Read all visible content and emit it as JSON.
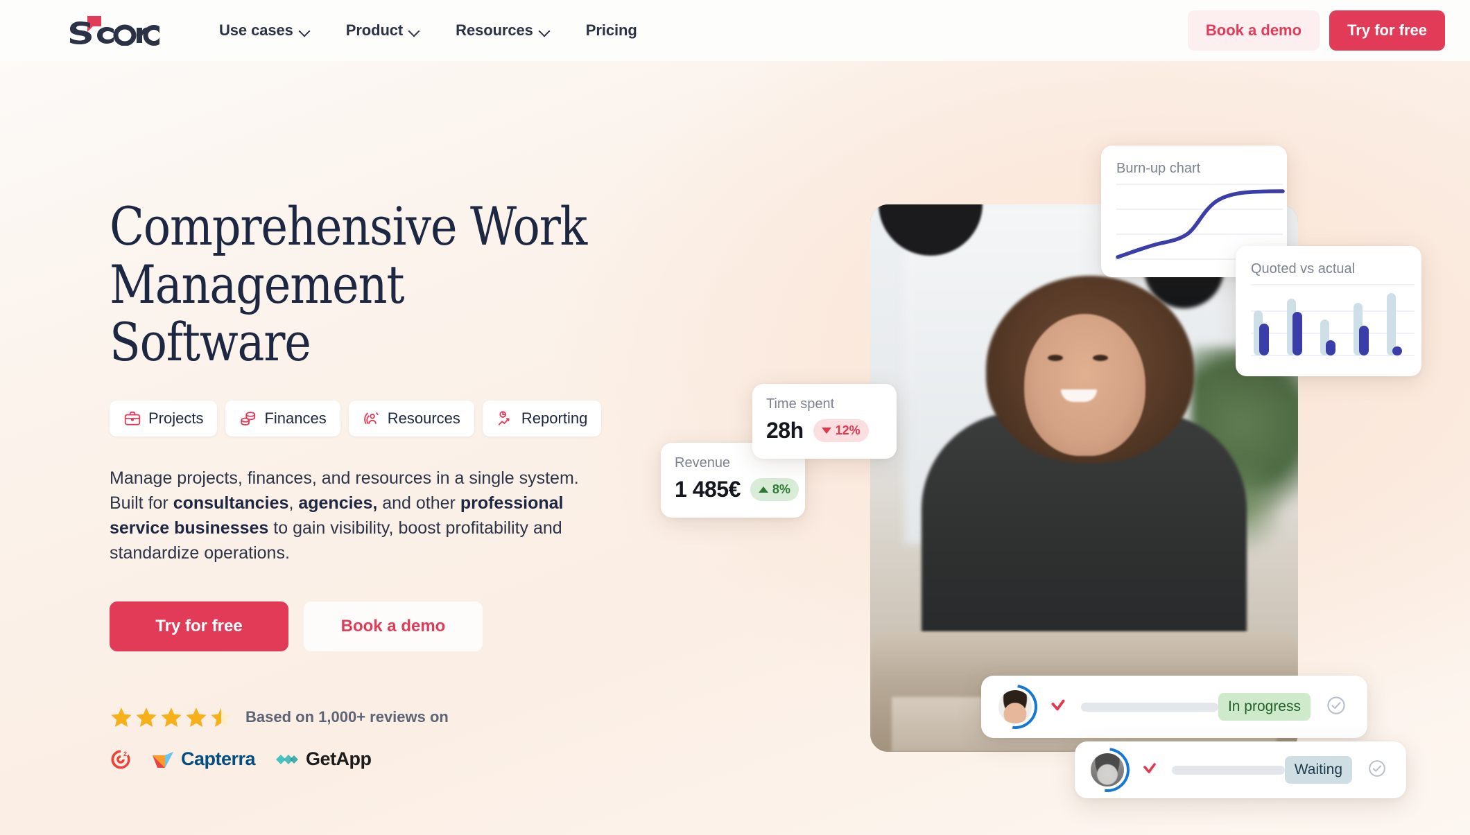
{
  "brand": {
    "name": "Scoro",
    "primary_color": "#e23b58",
    "text_color": "#1e2742"
  },
  "header": {
    "logo_text": "Scoro",
    "nav": [
      {
        "label": "Use cases",
        "has_dropdown": true
      },
      {
        "label": "Product",
        "has_dropdown": true
      },
      {
        "label": "Resources",
        "has_dropdown": true
      },
      {
        "label": "Pricing",
        "has_dropdown": false
      }
    ],
    "book_demo_label": "Book a demo",
    "try_free_label": "Try for free"
  },
  "hero": {
    "headline": "Comprehensive Work\nManagement Software",
    "pills": [
      {
        "label": "Projects",
        "icon": "briefcase-icon"
      },
      {
        "label": "Finances",
        "icon": "coins-icon"
      },
      {
        "label": "Resources",
        "icon": "person-target-icon"
      },
      {
        "label": "Reporting",
        "icon": "chart-line-icon"
      }
    ],
    "lede": {
      "part1": "Manage projects, finances, and resources in a single system. Built for ",
      "bold1": "consultancies",
      "part2": ", ",
      "bold2": "agencies,",
      "part3": " and other ",
      "bold3": "professional service businesses",
      "part4": " to gain visibility, boost profitability and standardize operations."
    },
    "cta_primary": "Try for free",
    "cta_secondary": "Book a demo"
  },
  "reviews": {
    "rating": 4.5,
    "max_rating": 5,
    "text": "Based on 1,000+ reviews on",
    "platforms": [
      {
        "name": "G2",
        "label": "",
        "icon": "g2-logo"
      },
      {
        "name": "Capterra",
        "label": "Capterra",
        "icon": "capterra-logo"
      },
      {
        "name": "GetApp",
        "label": "GetApp",
        "icon": "getapp-logo"
      }
    ]
  },
  "cards": {
    "burnup": {
      "title": "Burn-up chart"
    },
    "quoted": {
      "title": "Quoted vs actual"
    },
    "time_spent": {
      "title": "Time spent",
      "value": "28h",
      "delta": "12%",
      "direction": "down"
    },
    "revenue": {
      "title": "Revenue",
      "value": "1 485€",
      "delta": "8%",
      "direction": "up"
    }
  },
  "tasks": [
    {
      "avatar": "avatar-woman",
      "flag_icon": "red-check-icon",
      "status": "In progress",
      "complete_icon": "check-circle-icon"
    },
    {
      "avatar": "avatar-person",
      "flag_icon": "red-check-icon",
      "status": "Waiting",
      "complete_icon": "check-circle-icon"
    }
  ],
  "chart_data": [
    {
      "type": "line",
      "title": "Burn-up chart",
      "x": [
        0,
        1,
        2,
        3,
        4,
        5,
        6,
        7,
        8,
        9
      ],
      "series": [
        {
          "name": "Burn-up",
          "values": [
            5,
            16,
            24,
            29,
            33,
            42,
            58,
            72,
            80,
            84
          ],
          "color": "#3b3ea8"
        }
      ],
      "xlabel": "",
      "ylabel": "",
      "ylim": [
        0,
        100
      ],
      "grid": true,
      "legend": "none"
    },
    {
      "type": "bar",
      "title": "Quoted vs actual",
      "categories": [
        "1",
        "2",
        "3",
        "4",
        "5"
      ],
      "series": [
        {
          "name": "Quoted",
          "values": [
            62,
            84,
            45,
            76,
            92
          ],
          "color": "#cfdfe8"
        },
        {
          "name": "Actual",
          "values": [
            40,
            56,
            17,
            38,
            8
          ],
          "color": "#3b3ea8"
        }
      ],
      "xlabel": "",
      "ylabel": "",
      "ylim": [
        0,
        100
      ],
      "grid": true,
      "legend": "none"
    }
  ]
}
